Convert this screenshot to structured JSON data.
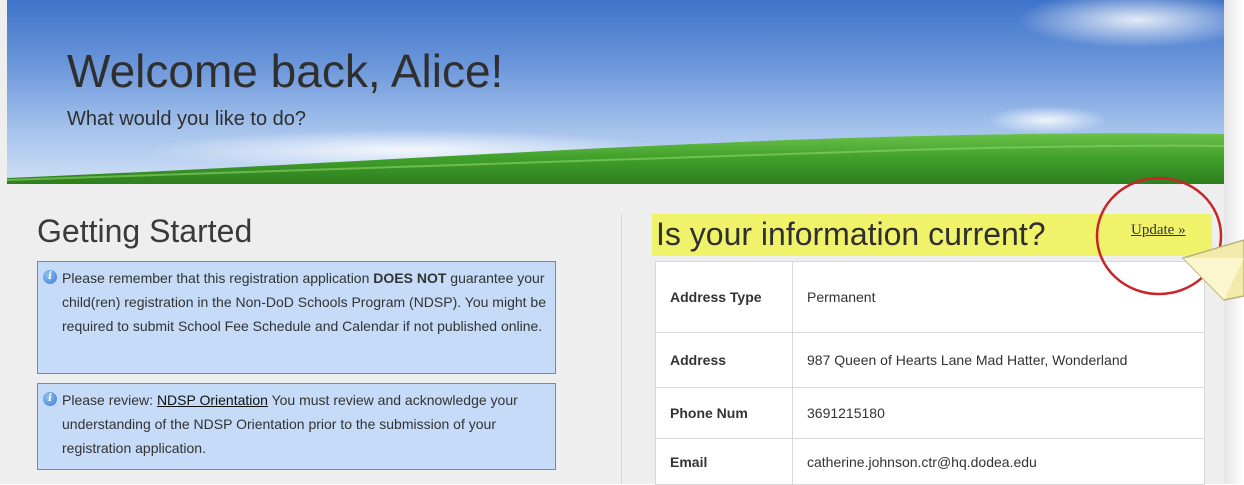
{
  "hero": {
    "title": "Welcome back, Alice!",
    "subtitle": "What would you like to do?"
  },
  "getting_started": {
    "title": "Getting Started",
    "notices": [
      {
        "icon": "info-icon",
        "text_before": "Please remember that this registration application ",
        "bold": "DOES NOT",
        "text_after": " guarantee your child(ren) registration in the Non-DoD Schools Program (NDSP). You might be required to submit School Fee Schedule and Calendar if not published online."
      },
      {
        "icon": "info-icon",
        "text_before": "Please review: ",
        "link": "NDSP Orientation",
        "text_after": " You must review and acknowledge your understanding of the NDSP Orientation prior to the submission of your registration application."
      }
    ]
  },
  "info": {
    "title": "Is your information current?",
    "update_label": "Update »",
    "rows": [
      {
        "label": "Address Type",
        "value": "Permanent"
      },
      {
        "label": "Address",
        "value": "987 Queen of Hearts Lane Mad Hatter, Wonderland"
      },
      {
        "label": "Phone Num",
        "value": "3691215180"
      },
      {
        "label": "Email",
        "value": "catherine.johnson.ctr@hq.dodea.edu"
      }
    ]
  },
  "colors": {
    "highlight": "#f0f26a",
    "notice_bg": "#c5dbf7",
    "annotation_circle": "#c8242b"
  }
}
